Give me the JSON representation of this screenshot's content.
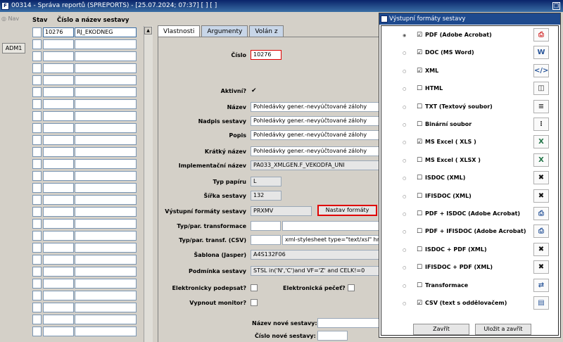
{
  "window": {
    "title": "00314 - Správa reportů (SPREPORTS) - [25.07.2024; 07:37]  [ ]  [ ]"
  },
  "left": {
    "nav": "Nav",
    "adm": "ADM1"
  },
  "list": {
    "headers": [
      "Stav",
      "Číslo a název sestavy"
    ],
    "rows": [
      {
        "cislo": "10276",
        "nazev": "RJ_EKODNEG"
      },
      {
        "cislo": "",
        "nazev": ""
      },
      {
        "cislo": "",
        "nazev": ""
      },
      {
        "cislo": "",
        "nazev": ""
      },
      {
        "cislo": "",
        "nazev": ""
      },
      {
        "cislo": "",
        "nazev": ""
      },
      {
        "cislo": "",
        "nazev": ""
      },
      {
        "cislo": "",
        "nazev": ""
      },
      {
        "cislo": "",
        "nazev": ""
      },
      {
        "cislo": "",
        "nazev": ""
      },
      {
        "cislo": "",
        "nazev": ""
      },
      {
        "cislo": "",
        "nazev": ""
      },
      {
        "cislo": "",
        "nazev": ""
      },
      {
        "cislo": "",
        "nazev": ""
      },
      {
        "cislo": "",
        "nazev": ""
      },
      {
        "cislo": "",
        "nazev": ""
      },
      {
        "cislo": "",
        "nazev": ""
      },
      {
        "cislo": "",
        "nazev": ""
      },
      {
        "cislo": "",
        "nazev": ""
      },
      {
        "cislo": "",
        "nazev": ""
      },
      {
        "cislo": "",
        "nazev": ""
      },
      {
        "cislo": "",
        "nazev": ""
      },
      {
        "cislo": "",
        "nazev": ""
      },
      {
        "cislo": "",
        "nazev": ""
      },
      {
        "cislo": "",
        "nazev": ""
      },
      {
        "cislo": "",
        "nazev": ""
      }
    ]
  },
  "tabs": [
    "Vlastnosti",
    "Argumenty",
    "Volán z"
  ],
  "form": {
    "cislo_label": "Číslo",
    "cislo": "10276",
    "aktivni_label": "Aktivní?",
    "nazev_label": "Název",
    "nazev": "Pohledávky gener.-nevyúčtované zálohy",
    "nadpis_label": "Nadpis sestavy",
    "nadpis": "Pohledávky gener.-nevyúčtované zálohy",
    "popis_label": "Popis",
    "popis": "Pohledávky gener.-nevyúčtované zálohy",
    "kratky_label": "Krátký název",
    "kratky": "Pohledávky gener.-nevyúčtované zálohy",
    "impl_label": "Implementační název",
    "impl": "PA033_XMLGEN.F_VEKODFA_UNI",
    "typpap_label": "Typ papíru",
    "typpap": "L",
    "sirka_label": "Šířka sestavy",
    "sirka": "132",
    "vystup_label": "Výstupní formáty sestavy",
    "vystup": "PRXMV",
    "nastav_button": "Nastav formáty",
    "typtransf_label": "Typ/par. transformace",
    "typcsv_label": "Typ/par. transf. (CSV)",
    "typcsv_val": "xml-stylesheet type=\"text/xsl\" href=",
    "sablona_label": "Šablona (Jasper)",
    "sablona": "A4S132F06",
    "podminka_label": "Podmínka sestavy",
    "podminka": "STSL in('N','C')and VF='Z' and CELK!=0",
    "podpis_label": "Elektronicky podepsat?",
    "pecet_label": "Elektronická pečeť?",
    "monitor_label": "Vypnout monitor?",
    "novy_nazev_label": "Název nové sestavy:",
    "nove_cislo_label": "Číslo nové sestavy:"
  },
  "dialog": {
    "title": "Výstupní formáty sestavy",
    "formats": [
      {
        "name": "PDF (Adobe Acrobat)",
        "checked": true,
        "radio": true,
        "icon": "pdf-icon",
        "color": "#d32f2f",
        "glyph": "⎙"
      },
      {
        "name": "DOC (MS Word)",
        "checked": true,
        "radio": false,
        "icon": "word-icon",
        "color": "#2b579a",
        "glyph": "W"
      },
      {
        "name": "XML",
        "checked": true,
        "radio": false,
        "icon": "code-icon",
        "color": "#2b579a",
        "glyph": "</>"
      },
      {
        "name": "HTML",
        "checked": false,
        "radio": false,
        "icon": "html-icon",
        "color": "#333333",
        "glyph": "◫"
      },
      {
        "name": "TXT (Textový soubor)",
        "checked": false,
        "radio": false,
        "icon": "text-file-icon",
        "color": "#333333",
        "glyph": "≡"
      },
      {
        "name": "Binární soubor",
        "checked": false,
        "radio": false,
        "icon": "binary-file-icon",
        "color": "#333333",
        "glyph": "⁝"
      },
      {
        "name": "MS Excel ( XLS )",
        "checked": true,
        "radio": false,
        "icon": "excel-icon",
        "color": "#217346",
        "glyph": "X"
      },
      {
        "name": "MS Excel ( XLSX )",
        "checked": false,
        "radio": false,
        "icon": "excel-icon",
        "color": "#217346",
        "glyph": "X"
      },
      {
        "name": "ISDOC (XML)",
        "checked": false,
        "radio": false,
        "icon": "isdoc-icon",
        "color": "#111111",
        "glyph": "✖"
      },
      {
        "name": "IFISDOC (XML)",
        "checked": false,
        "radio": false,
        "icon": "isdoc-icon",
        "color": "#111111",
        "glyph": "✖"
      },
      {
        "name": "PDF + ISDOC (Adobe Acrobat)",
        "checked": false,
        "radio": false,
        "icon": "pdf-isdoc-icon",
        "color": "#2b579a",
        "glyph": "⎙"
      },
      {
        "name": "PDF + IFISDOC (Adobe Acrobat)",
        "checked": false,
        "radio": false,
        "icon": "pdf-isdoc-icon",
        "color": "#2b579a",
        "glyph": "⎙"
      },
      {
        "name": "ISDOC + PDF (XML)",
        "checked": false,
        "radio": false,
        "icon": "isdoc-icon",
        "color": "#111111",
        "glyph": "✖"
      },
      {
        "name": "IFISDOC + PDF (XML)",
        "checked": false,
        "radio": false,
        "icon": "isdoc-icon",
        "color": "#111111",
        "glyph": "✖"
      },
      {
        "name": "Transformace",
        "checked": false,
        "radio": false,
        "icon": "transform-icon",
        "color": "#2b579a",
        "glyph": "⇄"
      },
      {
        "name": "CSV (text s oddělovačem)",
        "checked": true,
        "radio": false,
        "icon": "csv-icon",
        "color": "#2b579a",
        "glyph": "▤"
      }
    ],
    "zavrit": "Zavřít",
    "ulozit": "Uložit a zavřít"
  }
}
